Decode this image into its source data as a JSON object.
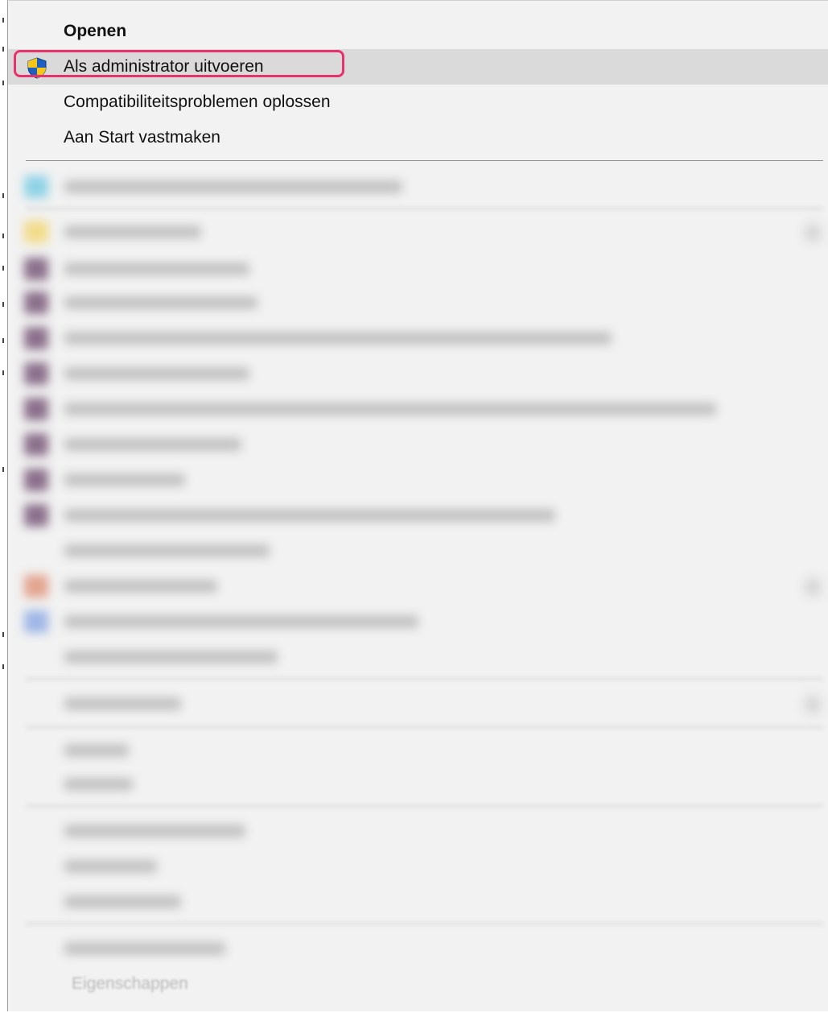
{
  "context_menu": {
    "items": [
      {
        "label": "Openen",
        "bold": true,
        "icon": null,
        "highlighted": false
      },
      {
        "label": "Als administrator uitvoeren",
        "bold": false,
        "icon": "uac-shield-icon",
        "highlighted": true
      },
      {
        "label": "Compatibiliteitsproblemen oplossen",
        "bold": false,
        "icon": null,
        "highlighted": false
      },
      {
        "label": "Aan Start vastmaken",
        "bold": false,
        "icon": null,
        "highlighted": false
      }
    ],
    "last_item_label": "Eigenschappen"
  },
  "colors": {
    "menu_background": "#f2f2f2",
    "highlight": "#dadada",
    "focus_ring": "#e8326b",
    "shield_blue": "#1f5fbf",
    "shield_yellow": "#f5c518"
  }
}
